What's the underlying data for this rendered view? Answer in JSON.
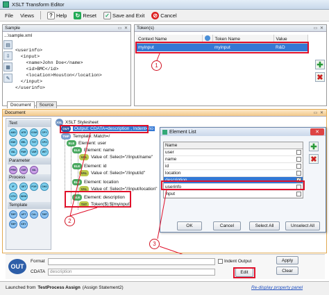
{
  "window": {
    "title": "XSLT Transform Editor"
  },
  "menu": {
    "file": "File",
    "views": "Views"
  },
  "toolbar": {
    "help": "Help",
    "reset": "Reset",
    "save_exit": "Save and Exit",
    "cancel": "Cancel"
  },
  "sample_panel": {
    "title": "Sample",
    "file": "...\\sample.xml",
    "xml_lines": [
      "<userinfo>",
      "  <input>",
      "    <name>John Doe</name>",
      "    <id>BMC</id>",
      "    <location>Houston</location>",
      "  </input>",
      "</userinfo>"
    ]
  },
  "token_panel": {
    "title": "Token(s)",
    "columns": [
      "Context Name",
      "Token Name",
      "Value"
    ],
    "rows": [
      {
        "context": "myinput",
        "token": "myinput",
        "value": "R&D"
      }
    ]
  },
  "tabs": {
    "document": "Document",
    "source": "Source"
  },
  "document_panel": {
    "title": "Document"
  },
  "palette": {
    "sections": [
      {
        "name": "Text",
        "items": [
          "ADD",
          "ATR",
          "COM",
          "CPY",
          "EDE",
          "EEL",
          "TXT",
          "CPO",
          "VAL",
          "PAR",
          "VAR",
          "WIT"
        ]
      },
      {
        "name": "Parameter",
        "items": [
          "PRM",
          "VAR",
          "VAL"
        ]
      },
      {
        "name": "Process",
        "items": [
          "IF",
          "SET",
          "FOR",
          "CHO",
          "OTH",
          "WHN"
        ]
      },
      {
        "name": "Template",
        "items": [
          "TMP",
          "APT",
          "CAL",
          "TMP",
          "TMP",
          "KEY"
        ]
      }
    ]
  },
  "tree": [
    {
      "badge": "XSL",
      "kind": "xsl",
      "label": "XSLT Stylesheet"
    },
    {
      "badge": "OUT",
      "kind": "out",
      "label": "Output: CDATA=description , Indent=no",
      "selected": true
    },
    {
      "badge": "TMP",
      "kind": "tmp",
      "label": "Template: Match=/"
    },
    {
      "badge": "ELE",
      "kind": "ele",
      "label": "Element: user"
    },
    {
      "badge": "ELE",
      "kind": "ele",
      "label": "Element: name"
    },
    {
      "badge": "VAL",
      "kind": "val",
      "label": "Value of: Select=\"//input/name\""
    },
    {
      "badge": "ELE",
      "kind": "ele",
      "label": "Element: id"
    },
    {
      "badge": "VAL",
      "kind": "val",
      "label": "Value of: Select=\"//input/id\""
    },
    {
      "badge": "ELE",
      "kind": "ele",
      "label": "Element: location"
    },
    {
      "badge": "VAL",
      "kind": "val",
      "label": "Value of: Select=\"//input/location\""
    },
    {
      "badge": "ELE",
      "kind": "ele",
      "label": "Element: description"
    },
    {
      "badge": "TXT",
      "kind": "val",
      "label": "Token($):$[myinput]"
    }
  ],
  "element_list": {
    "title": "Element List",
    "header": "Name",
    "items": [
      {
        "name": "user",
        "checked": false
      },
      {
        "name": "name",
        "checked": false
      },
      {
        "name": "id",
        "checked": false
      },
      {
        "name": "location",
        "checked": false
      },
      {
        "name": "description",
        "checked": true
      },
      {
        "name": "userinfo",
        "checked": false
      },
      {
        "name": "input",
        "checked": false
      }
    ],
    "buttons": {
      "ok": "OK",
      "cancel": "Cancel",
      "select_all": "Select All",
      "unselect_all": "Unselect All"
    }
  },
  "output": {
    "badge": "OUT",
    "format_label": "Format",
    "cdata_label": "CDATA",
    "cdata_value": "description",
    "indent_label": "Indent Output",
    "apply": "Apply",
    "clear": "Clear",
    "edit": "Edit"
  },
  "status": {
    "launched_prefix": "Launched from",
    "launched_bold": "TestProcess Assign",
    "launched_suffix": "(Assign Statement2)",
    "redisplay": "Re-display property panel"
  },
  "callouts": [
    "1",
    "2",
    "3"
  ],
  "colors": {
    "selection": "#3478d4",
    "highlight": "#e0102a"
  }
}
